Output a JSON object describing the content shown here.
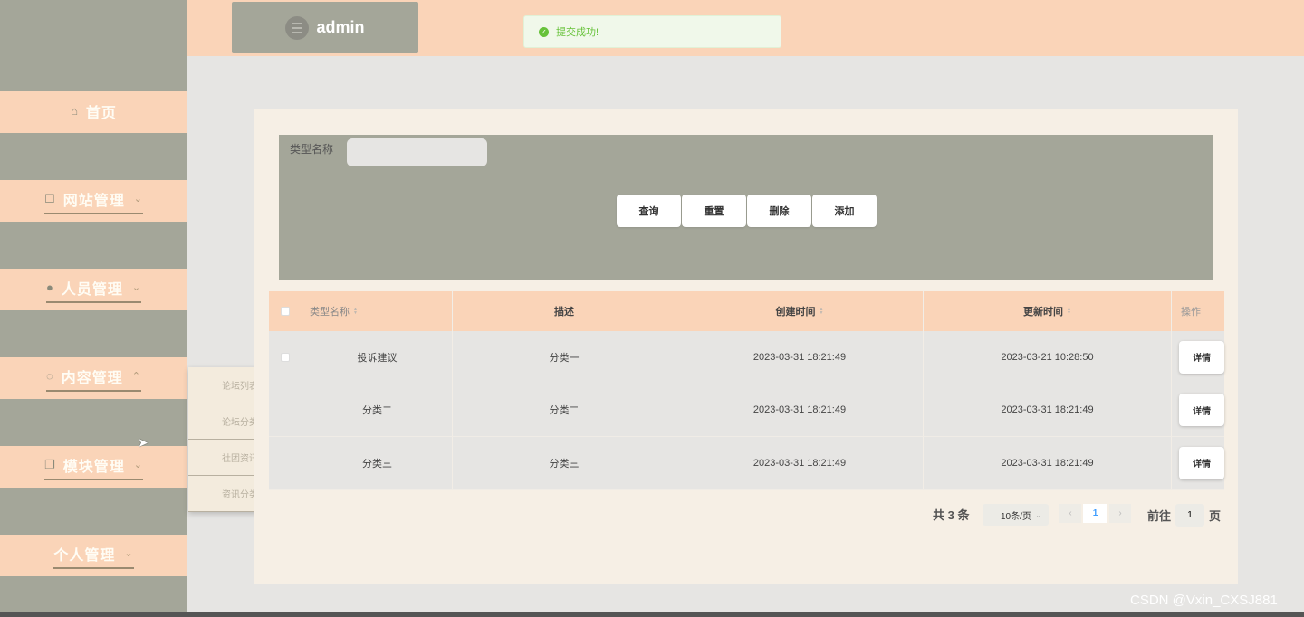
{
  "sidebar": {
    "items": [
      {
        "label": "首页",
        "icon": "home-icon",
        "glyph": "⌂",
        "chevron": ""
      },
      {
        "label": "网站管理",
        "icon": "screen-icon",
        "glyph": "☐",
        "chevron": "⌄"
      },
      {
        "label": "人员管理",
        "icon": "user-icon",
        "glyph": "●",
        "chevron": "⌄"
      },
      {
        "label": "内容管理",
        "icon": "chat-icon",
        "glyph": "◌",
        "chevron": "⌃"
      },
      {
        "label": "模块管理",
        "icon": "copy-icon",
        "glyph": "❐",
        "chevron": "⌄"
      },
      {
        "label": "个人管理",
        "icon": "",
        "glyph": "",
        "chevron": "⌄"
      }
    ],
    "submenu": [
      "论坛列表",
      "论坛分类",
      "社团资讯",
      "资讯分类"
    ]
  },
  "header": {
    "username": "admin",
    "toast": "提交成功!"
  },
  "search": {
    "label": "类型名称",
    "value": "",
    "buttons": {
      "query": "查询",
      "reset": "重置",
      "delete": "删除",
      "add": "添加"
    }
  },
  "table": {
    "headers": [
      "类型名称",
      "描述",
      "创建时间",
      "更新时间",
      "操作"
    ],
    "rows": [
      {
        "name": "投诉建议",
        "desc": "分类一",
        "created": "2023-03-31 18:21:49",
        "updated": "2023-03-21 10:28:50",
        "action": "详情"
      },
      {
        "name": "分类二",
        "desc": "分类二",
        "created": "2023-03-31 18:21:49",
        "updated": "2023-03-31 18:21:49",
        "action": "详情"
      },
      {
        "name": "分类三",
        "desc": "分类三",
        "created": "2023-03-31 18:21:49",
        "updated": "2023-03-31 18:21:49",
        "action": "详情"
      }
    ]
  },
  "pagination": {
    "total": "共 3 条",
    "page_size": "10条/页",
    "current_page": "1",
    "goto_label": "前往",
    "goto_value": "1",
    "goto_suffix": "页",
    "prev": "‹",
    "next": "›"
  },
  "watermark": "CSDN @Vxin_CXSJ881",
  "colors": {
    "sidebar_bg": "#a4a699",
    "accent_peach": "#fad4b8",
    "card_bg": "#f6efe5",
    "success": "#67c23a",
    "page_active": "#409eff"
  }
}
